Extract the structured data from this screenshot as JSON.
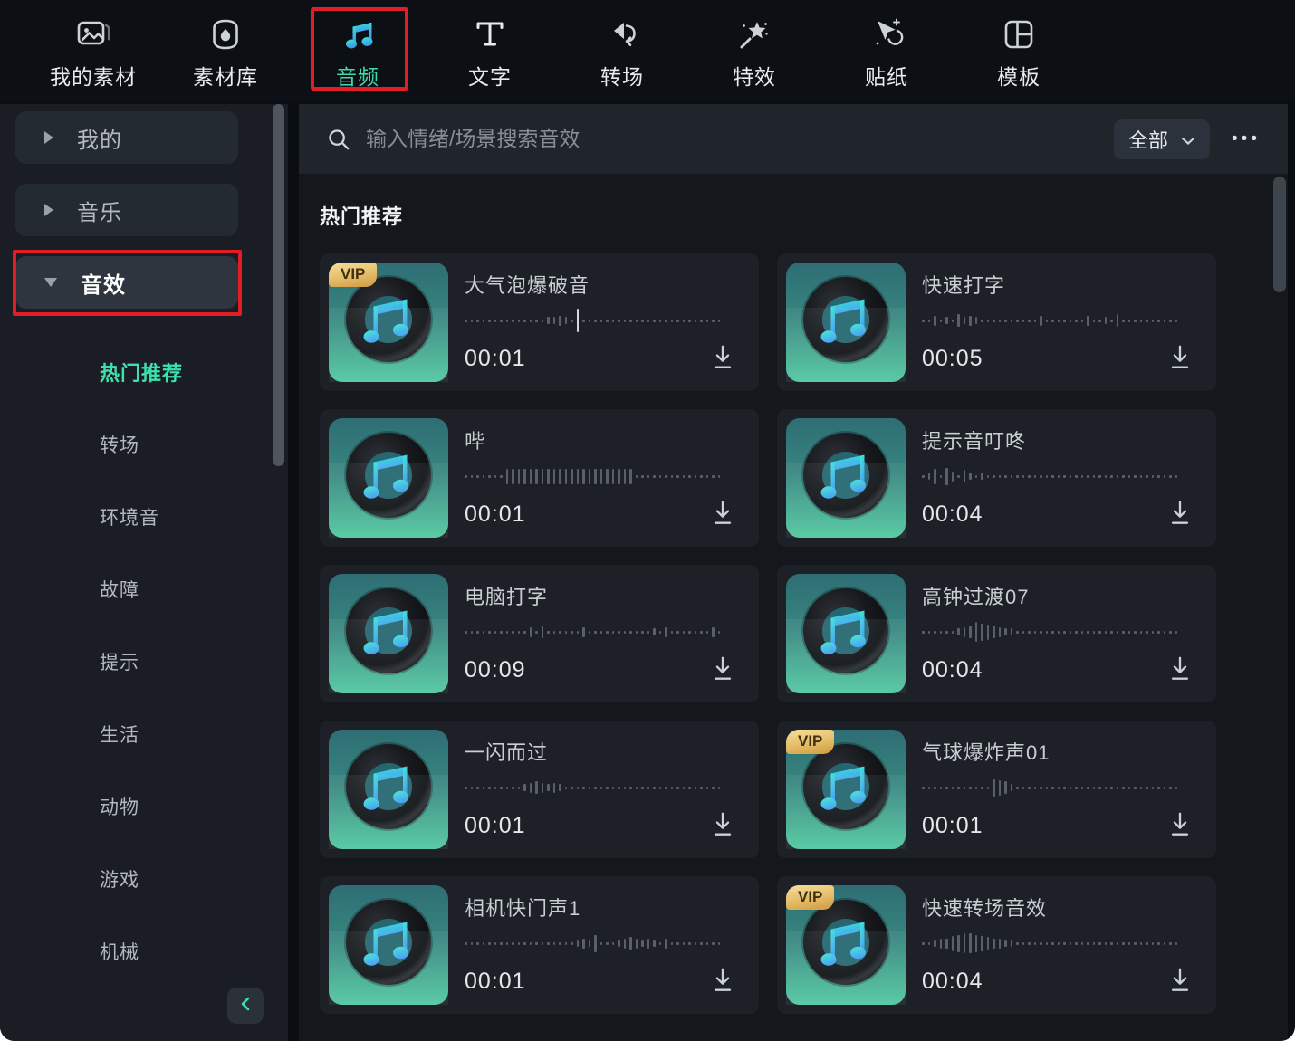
{
  "colors": {
    "accent_teal": "#3fe0b0",
    "annotation_red": "#e11d26",
    "vip_gold": "#e4bc68",
    "card_bg": "#1d2127",
    "sidebar_bg": "#1a1e24",
    "content_bg": "#14171c"
  },
  "nav": {
    "tabs": [
      {
        "label": "我的素材",
        "icon": "my-media-icon",
        "active": false,
        "annotated": false
      },
      {
        "label": "素材库",
        "icon": "stock-library-icon",
        "active": false,
        "annotated": false
      },
      {
        "label": "音频",
        "icon": "audio-icon",
        "active": true,
        "annotated": true
      },
      {
        "label": "文字",
        "icon": "text-icon",
        "active": false,
        "annotated": false
      },
      {
        "label": "转场",
        "icon": "transition-icon",
        "active": false,
        "annotated": false
      },
      {
        "label": "特效",
        "icon": "effects-icon",
        "active": false,
        "annotated": false
      },
      {
        "label": "贴纸",
        "icon": "sticker-icon",
        "active": false,
        "annotated": false
      },
      {
        "label": "模板",
        "icon": "template-icon",
        "active": false,
        "annotated": false
      }
    ]
  },
  "sidebar": {
    "groups": [
      {
        "label": "我的",
        "expanded": false,
        "selected": false,
        "annotated": false
      },
      {
        "label": "音乐",
        "expanded": false,
        "selected": false,
        "annotated": false
      },
      {
        "label": "音效",
        "expanded": true,
        "selected": true,
        "annotated": true
      }
    ],
    "categories": [
      {
        "label": "热门推荐",
        "active": true
      },
      {
        "label": "转场",
        "active": false
      },
      {
        "label": "环境音",
        "active": false
      },
      {
        "label": "故障",
        "active": false
      },
      {
        "label": "提示",
        "active": false
      },
      {
        "label": "生活",
        "active": false
      },
      {
        "label": "动物",
        "active": false
      },
      {
        "label": "游戏",
        "active": false
      },
      {
        "label": "机械",
        "active": false
      }
    ]
  },
  "search": {
    "placeholder": "输入情绪/场景搜索音效",
    "filter_label": "全部",
    "more_label": "•••"
  },
  "content": {
    "section_title": "热门推荐",
    "vip_label": "VIP",
    "cards": [
      {
        "title": "大气泡爆破音",
        "duration": "00:01",
        "vip": true,
        "wave": "11111111111111223219111111111111111111111111"
      },
      {
        "title": "快速打字",
        "duration": "00:05",
        "vip": false,
        "wave": "11312142321111111111311111113112141111111111"
      },
      {
        "title": "哔",
        "duration": "00:01",
        "vip": false,
        "wave": "11111115555555555555555555555111111111111111"
      },
      {
        "title": "提示音叮咚",
        "duration": "00:04",
        "vip": false,
        "wave": "12516314212111111111111111111111111111111111"
      },
      {
        "title": "电脑打字",
        "duration": "00:09",
        "vip": false,
        "wave": "11111111111314111111311111111111213111111131"
      },
      {
        "title": "高钟过渡07",
        "duration": "00:04",
        "vip": false,
        "wave": "11111123476543221111111111111111111111111111"
      },
      {
        "title": "一闪而过",
        "duration": "00:01",
        "vip": false,
        "wave": "11111111112343232111111111111111111111111111"
      },
      {
        "title": "气球爆炸声01",
        "duration": "00:01",
        "vip": true,
        "wave": "11111111111165421111111111111111111111111111"
      },
      {
        "title": "相机快门声1",
        "duration": "00:01",
        "vip": false,
        "wave": "11111111111111111112326111234323213111111111"
      },
      {
        "title": "快速转场音效",
        "duration": "00:04",
        "vip": true,
        "wave": "11233567765433221111111111111111111111111111"
      }
    ]
  }
}
